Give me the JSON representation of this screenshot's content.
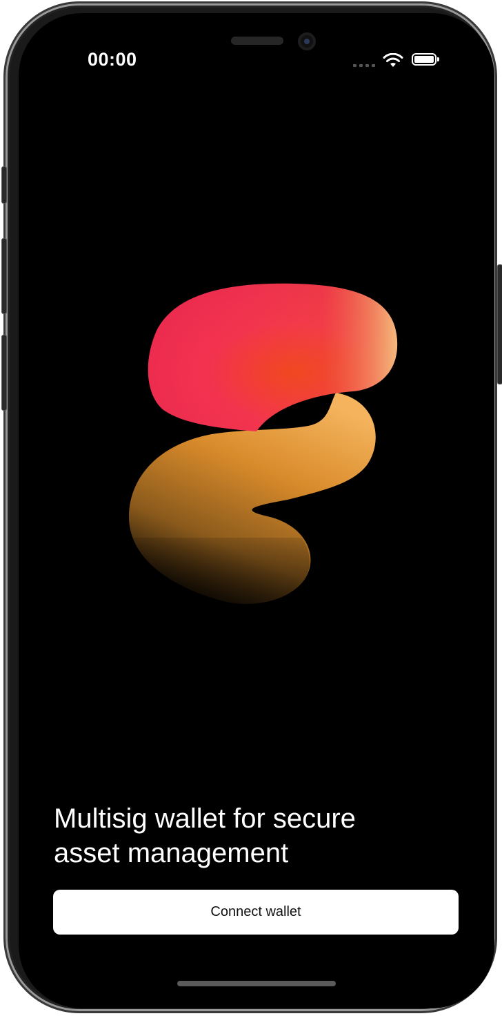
{
  "status_bar": {
    "time": "00:00",
    "icons": [
      "cellular-signal-icon",
      "wifi-icon",
      "battery-icon"
    ]
  },
  "logo": {
    "icon": "brand-logo-icon",
    "colors": {
      "top": "#f2314f",
      "middle": "#f0421c",
      "highlight": "#f4c982",
      "bottom": "#b07a22"
    }
  },
  "onboarding": {
    "headline": "Multisig wallet for secure\nasset management",
    "connect_button_label": "Connect wallet"
  },
  "colors": {
    "background": "#000000",
    "text": "#ffffff",
    "button_bg": "#ffffff",
    "button_text": "#111111"
  }
}
